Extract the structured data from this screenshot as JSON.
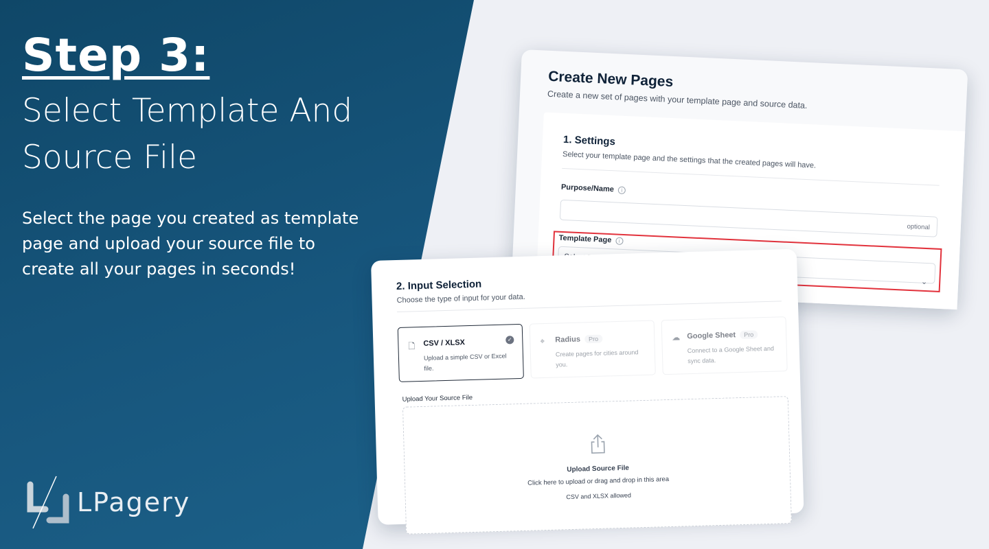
{
  "hero": {
    "title": "Step 3:",
    "subtitle_line1": "Select Template And",
    "subtitle_line2": "Source File",
    "body": "Select the page you created as template page and upload your source file to create all your pages in seconds!"
  },
  "brand": {
    "name": "LPagery"
  },
  "create_card": {
    "title": "Create New Pages",
    "description": "Create a new set of pages with your template page and source data.",
    "settings": {
      "title": "1. Settings",
      "description": "Select your template page and the settings that the created pages will have.",
      "purpose_label": "Purpose/Name",
      "purpose_hint": "optional",
      "template_label": "Template Page",
      "template_placeholder": "Select Page"
    }
  },
  "input_card": {
    "title": "2. Input Selection",
    "description": "Choose the type of input for your data.",
    "options": [
      {
        "label": "CSV / XLSX",
        "description": "Upload a simple CSV or Excel file.",
        "icon": "file-icon",
        "selected": true
      },
      {
        "label": "Radius",
        "badge": "Pro",
        "description": "Create pages for cities around you.",
        "icon": "pin-icon"
      },
      {
        "label": "Google Sheet",
        "badge": "Pro",
        "description": "Connect to a Google Sheet and sync data.",
        "icon": "cloud-icon"
      }
    ],
    "upload": {
      "label": "Upload Your Source File",
      "title": "Upload Source File",
      "description": "Click here to upload or drag and drop in this area",
      "hint": "CSV and XLSX allowed"
    }
  },
  "colors": {
    "panel": "#17567d",
    "highlight": "#e2323c",
    "ink": "#0f2238"
  }
}
